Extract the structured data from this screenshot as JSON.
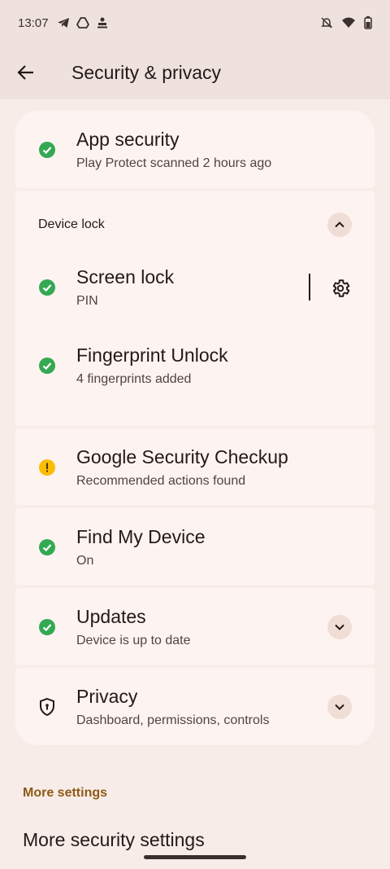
{
  "status_bar": {
    "time": "13:07",
    "left_icons": [
      "telegram-icon",
      "drive-icon",
      "notification-icon"
    ],
    "right_icons": [
      "mute-icon",
      "wifi-icon",
      "battery-icon"
    ]
  },
  "app_bar": {
    "title": "Security & privacy"
  },
  "items": {
    "app_security": {
      "title": "App security",
      "subtitle": "Play Protect scanned 2 hours ago",
      "status": "ok"
    },
    "device_lock_header": "Device lock",
    "screen_lock": {
      "title": "Screen lock",
      "subtitle": "PIN",
      "status": "ok"
    },
    "fingerprint": {
      "title": "Fingerprint Unlock",
      "subtitle": "4 fingerprints added",
      "status": "ok"
    },
    "google_checkup": {
      "title": "Google Security Checkup",
      "subtitle": "Recommended actions found",
      "status": "warning"
    },
    "find_device": {
      "title": "Find My Device",
      "subtitle": "On",
      "status": "ok"
    },
    "updates": {
      "title": "Updates",
      "subtitle": "Device is up to date",
      "status": "ok"
    },
    "privacy": {
      "title": "Privacy",
      "subtitle": "Dashboard, permissions, controls"
    }
  },
  "more_settings": {
    "section_label": "More settings",
    "first_item": "More security settings"
  },
  "colors": {
    "background": "#f8ece8",
    "card": "#fdf4f1",
    "ok_green": "#34a853",
    "warning_yellow": "#fbbc04",
    "accent_brown": "#8b5a17"
  }
}
